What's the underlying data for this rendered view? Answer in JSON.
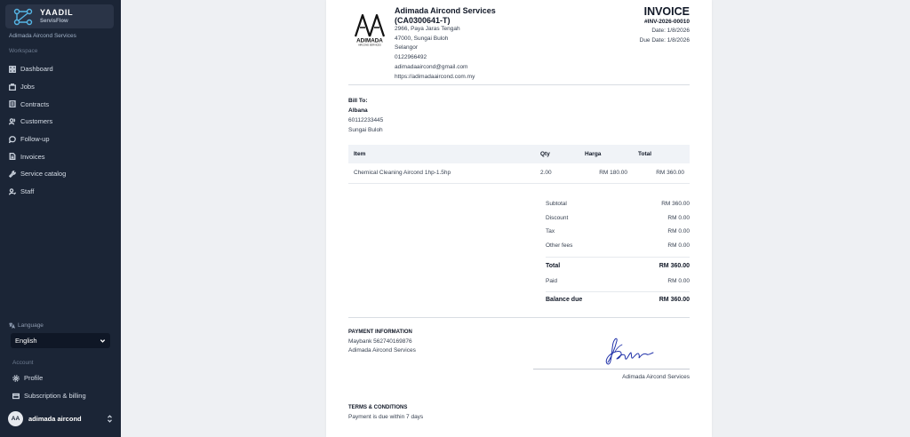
{
  "sidebar": {
    "brand_title": "YAADIL",
    "brand_subtitle": "ServisFlow",
    "org_name": "Adimada Aircond Services",
    "workspace_label": "Workspace",
    "nav": [
      {
        "label": "Dashboard",
        "icon": "dashboard-icon"
      },
      {
        "label": "Jobs",
        "icon": "jobs-icon"
      },
      {
        "label": "Contracts",
        "icon": "contracts-icon"
      },
      {
        "label": "Customers",
        "icon": "customers-icon"
      },
      {
        "label": "Follow-up",
        "icon": "follow-up-icon"
      },
      {
        "label": "Invoices",
        "icon": "invoices-icon"
      },
      {
        "label": "Service catalog",
        "icon": "wrench-icon"
      },
      {
        "label": "Staff",
        "icon": "staff-icon"
      }
    ],
    "language_label": "Language",
    "language_value": "English",
    "account_label": "Account",
    "profile_label": "Profile",
    "billing_label": "Subscription & billing",
    "user_initials": "AA",
    "user_name": "adimada aircond"
  },
  "invoice": {
    "logo_text": "ADIMADA",
    "logo_subtext": "AIRCOND SERVICES",
    "company_name": "Adimada Aircond Services",
    "company_reg": "(CA0300641-T)",
    "address_1": "2966, Paya Jaras Tengah",
    "address_2": "47000, Sungai Buloh",
    "address_3": "Selangor",
    "phone": "0122966492",
    "email": "adimadaaircond@gmail.com",
    "website": "https://adimadaaircond.com.my",
    "title": "INVOICE",
    "number": "#INV-2026-00010",
    "date": "Date: 1/8/2026",
    "due_date": "Due Date: 1/8/2026",
    "bill_to_label": "Bill To:",
    "bill_name": "Albana",
    "bill_phone": "60112233445",
    "bill_location": "Sungai Buloh",
    "columns": {
      "item": "Item",
      "qty": "Qty",
      "price": "Harga",
      "total": "Total"
    },
    "items": [
      {
        "item": "Chemical Cleaning Aircond 1hp-1.5hp",
        "qty": "2.00",
        "price": "RM 180.00",
        "total": "RM 360.00"
      }
    ],
    "subtotal_label": "Subtotal",
    "subtotal": "RM 360.00",
    "discount_label": "Discount",
    "discount": "RM 0.00",
    "tax_label": "Tax",
    "tax": "RM 0.00",
    "other_fees_label": "Other fees",
    "other_fees": "RM 0.00",
    "total_label": "Total",
    "total": "RM 360.00",
    "paid_label": "Paid",
    "paid": "RM 0.00",
    "balance_label": "Balance due",
    "balance": "RM 360.00",
    "payment_title": "PAYMENT INFORMATION",
    "payment_bank": "Maybank 562740169876",
    "payment_name": "Adimada Aircond Services",
    "signature_name": "Adimada Aircond Services",
    "terms_title": "TERMS & CONDITIONS",
    "terms_text": "Payment is due within 7 days"
  }
}
